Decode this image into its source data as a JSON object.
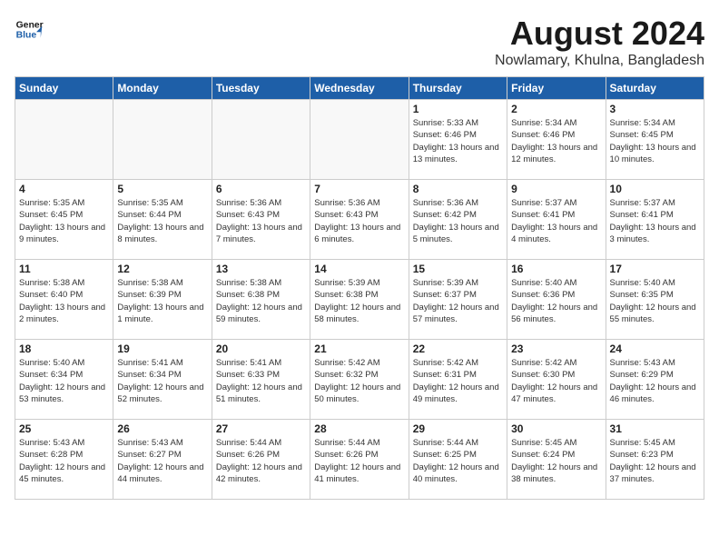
{
  "header": {
    "logo_line1": "General",
    "logo_line2": "Blue",
    "month_title": "August 2024",
    "subtitle": "Nowlamary, Khulna, Bangladesh"
  },
  "weekdays": [
    "Sunday",
    "Monday",
    "Tuesday",
    "Wednesday",
    "Thursday",
    "Friday",
    "Saturday"
  ],
  "weeks": [
    [
      {
        "day": "",
        "info": ""
      },
      {
        "day": "",
        "info": ""
      },
      {
        "day": "",
        "info": ""
      },
      {
        "day": "",
        "info": ""
      },
      {
        "day": "1",
        "info": "Sunrise: 5:33 AM\nSunset: 6:46 PM\nDaylight: 13 hours\nand 13 minutes."
      },
      {
        "day": "2",
        "info": "Sunrise: 5:34 AM\nSunset: 6:46 PM\nDaylight: 13 hours\nand 12 minutes."
      },
      {
        "day": "3",
        "info": "Sunrise: 5:34 AM\nSunset: 6:45 PM\nDaylight: 13 hours\nand 10 minutes."
      }
    ],
    [
      {
        "day": "4",
        "info": "Sunrise: 5:35 AM\nSunset: 6:45 PM\nDaylight: 13 hours\nand 9 minutes."
      },
      {
        "day": "5",
        "info": "Sunrise: 5:35 AM\nSunset: 6:44 PM\nDaylight: 13 hours\nand 8 minutes."
      },
      {
        "day": "6",
        "info": "Sunrise: 5:36 AM\nSunset: 6:43 PM\nDaylight: 13 hours\nand 7 minutes."
      },
      {
        "day": "7",
        "info": "Sunrise: 5:36 AM\nSunset: 6:43 PM\nDaylight: 13 hours\nand 6 minutes."
      },
      {
        "day": "8",
        "info": "Sunrise: 5:36 AM\nSunset: 6:42 PM\nDaylight: 13 hours\nand 5 minutes."
      },
      {
        "day": "9",
        "info": "Sunrise: 5:37 AM\nSunset: 6:41 PM\nDaylight: 13 hours\nand 4 minutes."
      },
      {
        "day": "10",
        "info": "Sunrise: 5:37 AM\nSunset: 6:41 PM\nDaylight: 13 hours\nand 3 minutes."
      }
    ],
    [
      {
        "day": "11",
        "info": "Sunrise: 5:38 AM\nSunset: 6:40 PM\nDaylight: 13 hours\nand 2 minutes."
      },
      {
        "day": "12",
        "info": "Sunrise: 5:38 AM\nSunset: 6:39 PM\nDaylight: 13 hours\nand 1 minute."
      },
      {
        "day": "13",
        "info": "Sunrise: 5:38 AM\nSunset: 6:38 PM\nDaylight: 12 hours\nand 59 minutes."
      },
      {
        "day": "14",
        "info": "Sunrise: 5:39 AM\nSunset: 6:38 PM\nDaylight: 12 hours\nand 58 minutes."
      },
      {
        "day": "15",
        "info": "Sunrise: 5:39 AM\nSunset: 6:37 PM\nDaylight: 12 hours\nand 57 minutes."
      },
      {
        "day": "16",
        "info": "Sunrise: 5:40 AM\nSunset: 6:36 PM\nDaylight: 12 hours\nand 56 minutes."
      },
      {
        "day": "17",
        "info": "Sunrise: 5:40 AM\nSunset: 6:35 PM\nDaylight: 12 hours\nand 55 minutes."
      }
    ],
    [
      {
        "day": "18",
        "info": "Sunrise: 5:40 AM\nSunset: 6:34 PM\nDaylight: 12 hours\nand 53 minutes."
      },
      {
        "day": "19",
        "info": "Sunrise: 5:41 AM\nSunset: 6:34 PM\nDaylight: 12 hours\nand 52 minutes."
      },
      {
        "day": "20",
        "info": "Sunrise: 5:41 AM\nSunset: 6:33 PM\nDaylight: 12 hours\nand 51 minutes."
      },
      {
        "day": "21",
        "info": "Sunrise: 5:42 AM\nSunset: 6:32 PM\nDaylight: 12 hours\nand 50 minutes."
      },
      {
        "day": "22",
        "info": "Sunrise: 5:42 AM\nSunset: 6:31 PM\nDaylight: 12 hours\nand 49 minutes."
      },
      {
        "day": "23",
        "info": "Sunrise: 5:42 AM\nSunset: 6:30 PM\nDaylight: 12 hours\nand 47 minutes."
      },
      {
        "day": "24",
        "info": "Sunrise: 5:43 AM\nSunset: 6:29 PM\nDaylight: 12 hours\nand 46 minutes."
      }
    ],
    [
      {
        "day": "25",
        "info": "Sunrise: 5:43 AM\nSunset: 6:28 PM\nDaylight: 12 hours\nand 45 minutes."
      },
      {
        "day": "26",
        "info": "Sunrise: 5:43 AM\nSunset: 6:27 PM\nDaylight: 12 hours\nand 44 minutes."
      },
      {
        "day": "27",
        "info": "Sunrise: 5:44 AM\nSunset: 6:26 PM\nDaylight: 12 hours\nand 42 minutes."
      },
      {
        "day": "28",
        "info": "Sunrise: 5:44 AM\nSunset: 6:26 PM\nDaylight: 12 hours\nand 41 minutes."
      },
      {
        "day": "29",
        "info": "Sunrise: 5:44 AM\nSunset: 6:25 PM\nDaylight: 12 hours\nand 40 minutes."
      },
      {
        "day": "30",
        "info": "Sunrise: 5:45 AM\nSunset: 6:24 PM\nDaylight: 12 hours\nand 38 minutes."
      },
      {
        "day": "31",
        "info": "Sunrise: 5:45 AM\nSunset: 6:23 PM\nDaylight: 12 hours\nand 37 minutes."
      }
    ]
  ]
}
